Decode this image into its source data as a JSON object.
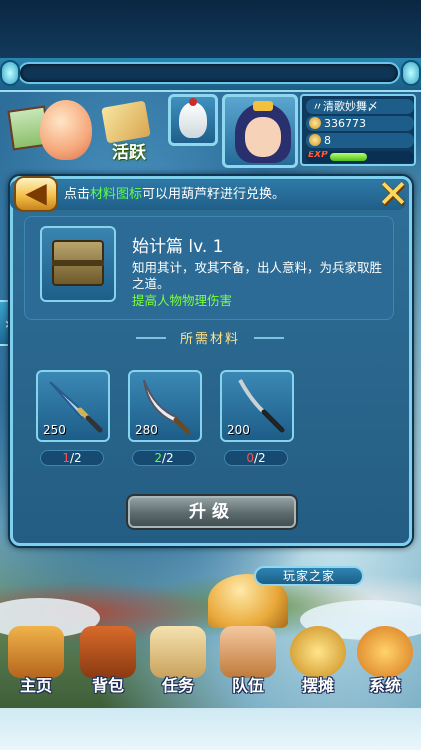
{
  "header": {
    "player_name": "〃清歌妙舞〆",
    "gold": "336773",
    "level": "8",
    "exp_label": "EXP",
    "exp_fill": 0.45
  },
  "top_icons": {
    "activity_label": "活跃"
  },
  "dialog": {
    "hint_prefix": "点击",
    "hint_highlight": "材料图标",
    "hint_suffix": "可以用葫芦籽进行兑换。",
    "back_symbol": "◀",
    "close_symbol": "✕",
    "book": {
      "name": "始计篇 lv. 1",
      "description": "知用其计，攻其不备，出人意料，为兵家取胜之道。",
      "effect": "提高人物物理伤害"
    },
    "materials_title": "所需材料",
    "materials": [
      {
        "count": "250",
        "have": "1",
        "need": "2",
        "status": "insufficient"
      },
      {
        "count": "280",
        "have": "2",
        "need": "2",
        "status": "sufficient"
      },
      {
        "count": "200",
        "have": "0",
        "need": "2",
        "status": "insufficient"
      }
    ],
    "upgrade_label": "升级"
  },
  "scene": {
    "player_home_label": "玩家之家"
  },
  "nav": [
    {
      "label": "主页",
      "icon": "home-icon"
    },
    {
      "label": "背包",
      "icon": "chest-icon"
    },
    {
      "label": "任务",
      "icon": "scroll-icon"
    },
    {
      "label": "队伍",
      "icon": "team-icon"
    },
    {
      "label": "摆摊",
      "icon": "stall-icon"
    },
    {
      "label": "系统",
      "icon": "gear-icon"
    }
  ],
  "colors": {
    "highlight_green": "#5cff4c",
    "warning_red": "#ff5050",
    "title_gold": "#ffe58a"
  }
}
